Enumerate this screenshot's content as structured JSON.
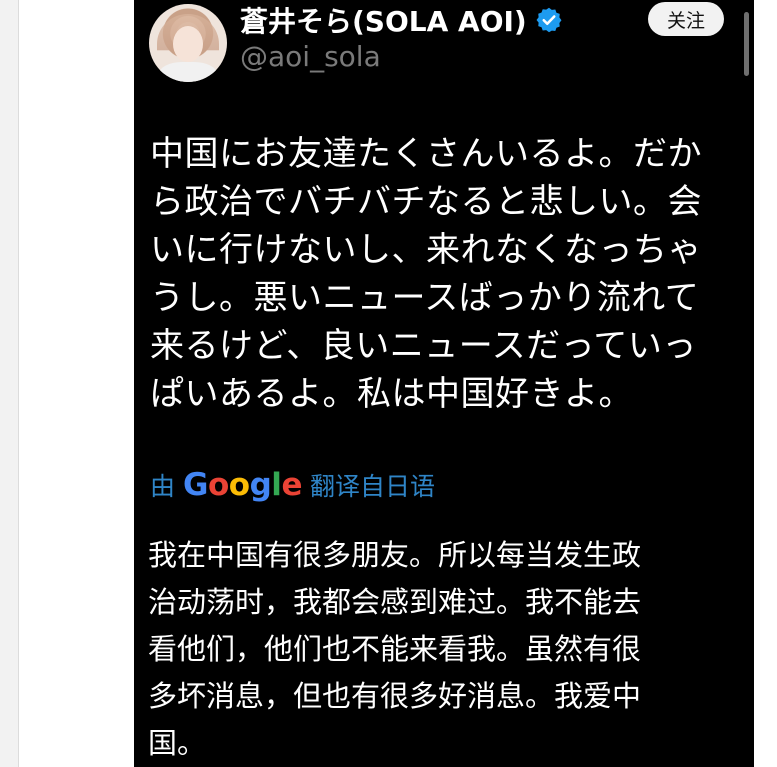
{
  "tweet": {
    "display_name": "蒼井そら(SOLA AOI)",
    "handle": "@aoi_sola",
    "verified_icon": "verified-badge-icon",
    "follow_label": "关注",
    "original_lines": [
      "中国にお友達たくさんいるよ。だか",
      "ら政治でバチバチなると悲しい。会",
      "いに行けないし、来れなくなっちゃ",
      "うし。悪いニュースばっかり流れて",
      "来るけど、良いニュースだっていっ",
      "ぱいあるよ。私は中国好きよ。"
    ],
    "translate": {
      "prefix": "由",
      "google": [
        "G",
        "o",
        "o",
        "g",
        "l",
        "e"
      ],
      "suffix": "翻译自日语"
    },
    "translated_lines": [
      "我在中国有很多朋友。所以每当发生政",
      "治动荡时，我都会感到难过。我不能去",
      "看他们，他们也不能来看我。虽然有很",
      "多坏消息，但也有很多好消息。我爱中",
      "国。"
    ]
  },
  "colors": {
    "verified": "#1d9bf0",
    "link": "#2f85c7"
  }
}
